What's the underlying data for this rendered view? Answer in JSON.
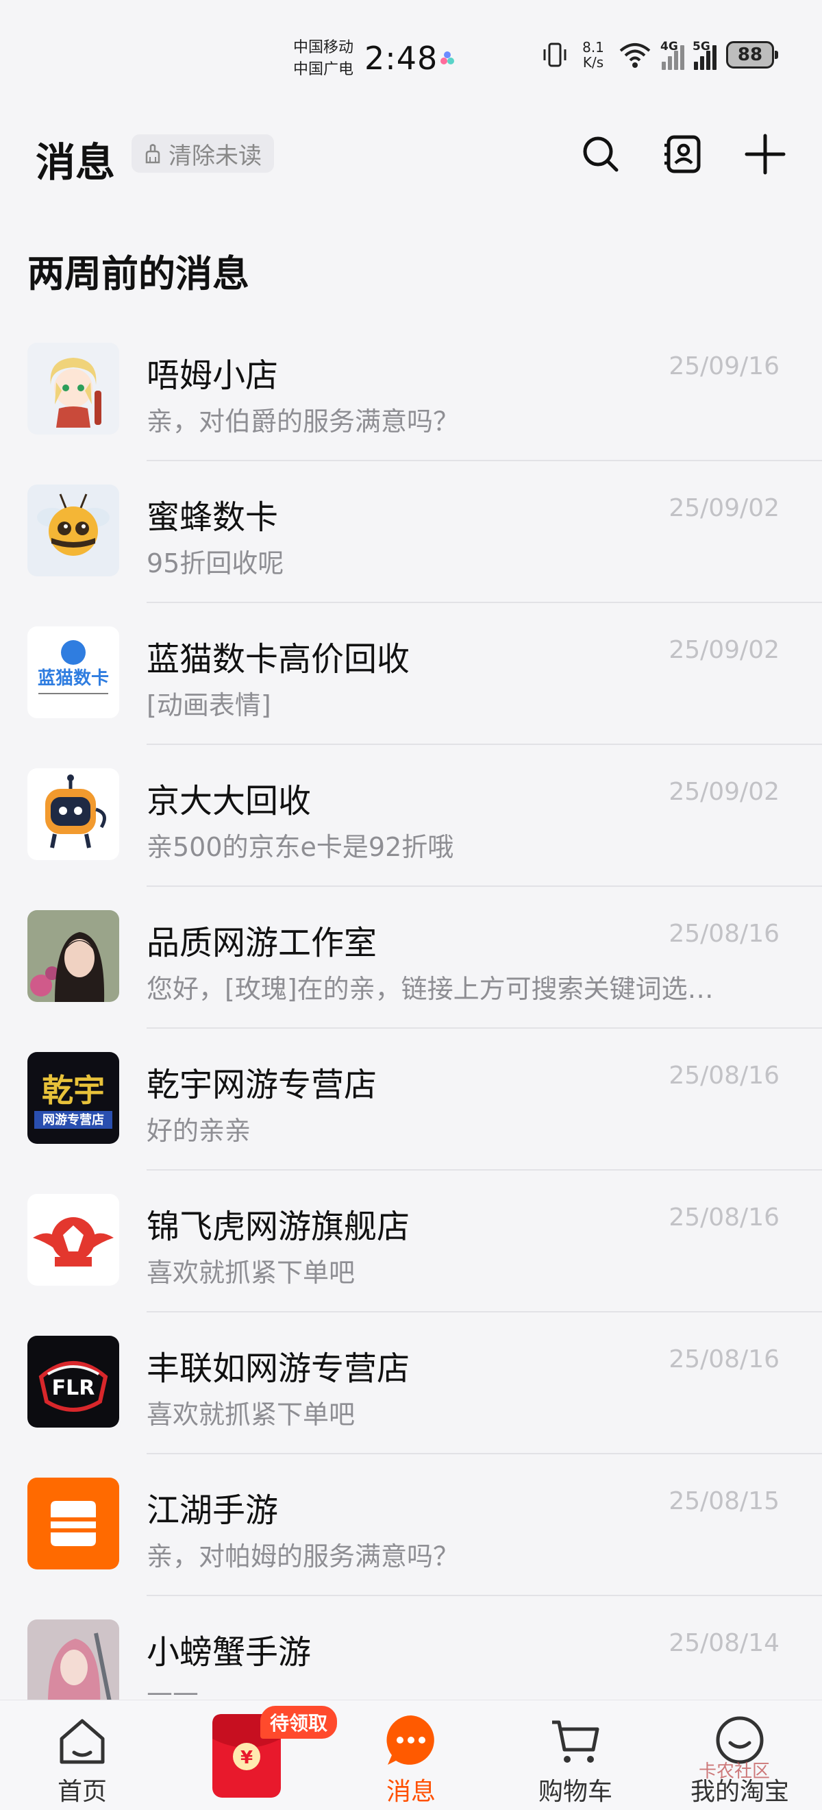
{
  "status_bar": {
    "carrier_1": "中国移动",
    "carrier_2": "中国广电",
    "time": "2:48",
    "net_speed_value": "8.1",
    "net_speed_unit": "K/s",
    "signal_1_type": "4G",
    "signal_2_type": "5G",
    "battery": "88"
  },
  "header": {
    "title": "消息",
    "clear_unread_label": "清除未读",
    "icons": [
      "search-icon",
      "contacts-icon",
      "plus-icon"
    ]
  },
  "section": {
    "label": "两周前的消息"
  },
  "conversations": [
    {
      "name": "唔姆小店",
      "preview": "亲，对伯爵的服务满意吗？",
      "date": "25/09/16"
    },
    {
      "name": "蜜蜂数卡",
      "preview": "95折回收呢",
      "date": "25/09/02"
    },
    {
      "name": "蓝猫数卡高价回收",
      "preview": "[动画表情]",
      "date": "25/09/02"
    },
    {
      "name": "京大大回收",
      "preview": "亲500的京东e卡是92折哦",
      "date": "25/09/02"
    },
    {
      "name": "品质网游工作室",
      "preview": "您好，[玫瑰]在的亲，链接上方可搜索关键词选…",
      "date": "25/08/16"
    },
    {
      "name": "乾宇网游专营店",
      "preview": "好的亲亲",
      "date": "25/08/16"
    },
    {
      "name": "锦飞虎网游旗舰店",
      "preview": "喜欢就抓紧下单吧",
      "date": "25/08/16"
    },
    {
      "name": "丰联如网游专营店",
      "preview": "喜欢就抓紧下单吧",
      "date": "25/08/16"
    },
    {
      "name": "江湖手游",
      "preview": "亲，对帕姆的服务满意吗？",
      "date": "25/08/15"
    },
    {
      "name": "小螃蟹手游",
      "preview": "——",
      "date": "25/08/14"
    }
  ],
  "avatar_text": {
    "lanmao": "蓝猫数卡",
    "qianyu_big": "乾宇",
    "qianyu_small": "网游专营店",
    "fenglian": "FLR"
  },
  "bottom_nav": {
    "home": "首页",
    "redpacket_badge": "待领取",
    "redpacket_symbol": "¥",
    "messages": "消息",
    "cart": "购物车",
    "my_taobao": "我的淘宝"
  },
  "watermark": "卡农社区",
  "colors": {
    "accent": "#ff5000",
    "background": "#f5f5f7",
    "redpacket": "#e8192c"
  }
}
